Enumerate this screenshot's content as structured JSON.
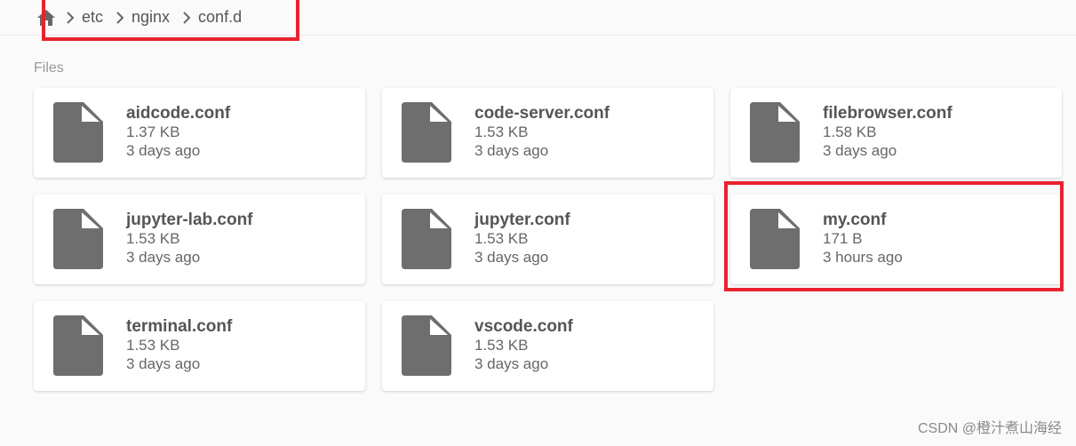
{
  "breadcrumb": {
    "home_icon": "home-icon",
    "items": [
      {
        "label": "etc"
      },
      {
        "label": "nginx"
      },
      {
        "label": "conf.d"
      }
    ]
  },
  "section": {
    "title": "Files"
  },
  "files": [
    {
      "name": "aidcode.conf",
      "size": "1.37 KB",
      "modified": "3 days ago"
    },
    {
      "name": "code-server.conf",
      "size": "1.53 KB",
      "modified": "3 days ago"
    },
    {
      "name": "filebrowser.conf",
      "size": "1.58 KB",
      "modified": "3 days ago"
    },
    {
      "name": "jupyter-lab.conf",
      "size": "1.53 KB",
      "modified": "3 days ago"
    },
    {
      "name": "jupyter.conf",
      "size": "1.53 KB",
      "modified": "3 days ago"
    },
    {
      "name": "my.conf",
      "size": "171 B",
      "modified": "3 hours ago"
    },
    {
      "name": "terminal.conf",
      "size": "1.53 KB",
      "modified": "3 days ago"
    },
    {
      "name": "vscode.conf",
      "size": "1.53 KB",
      "modified": "3 days ago"
    }
  ],
  "icons": {
    "file": "file-icon",
    "chevron": "chevron-right-icon"
  },
  "colors": {
    "annotation": "#e8232e",
    "file_icon": "#6e6e6e"
  },
  "watermark": "CSDN @橙汁煮山海经"
}
